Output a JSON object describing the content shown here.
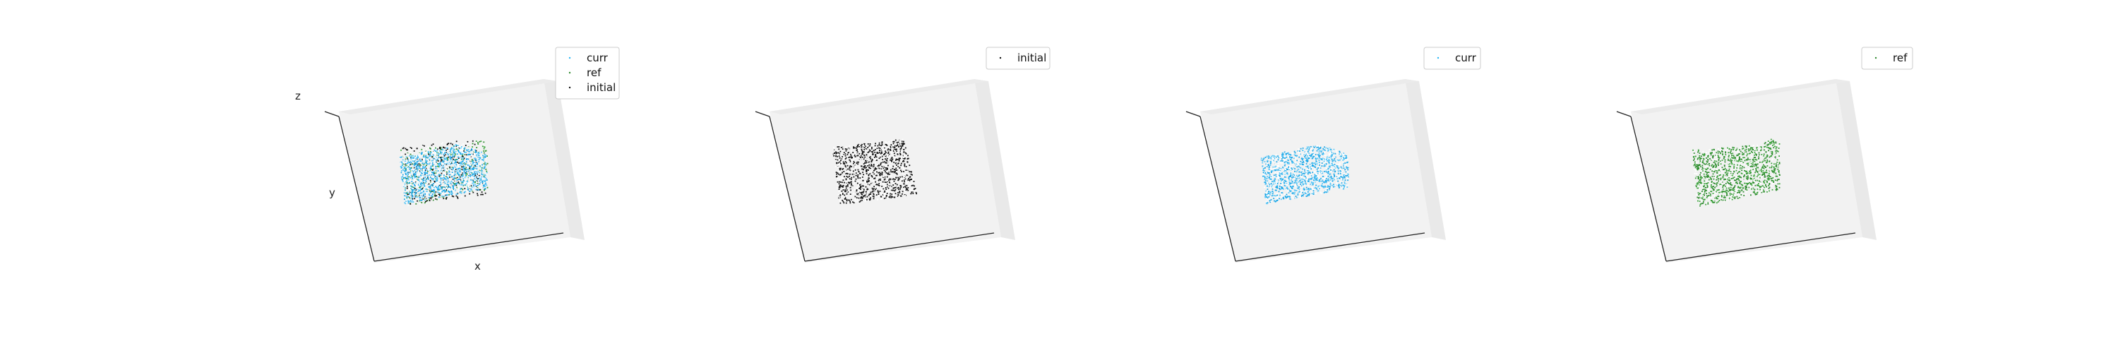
{
  "chart_data": [
    {
      "type": "scatter",
      "title": "",
      "xlabel": "x",
      "ylabel": "y",
      "zlabel": "z",
      "grid": false,
      "legend_placement": "top-right",
      "series": [
        {
          "name": "curr",
          "color": "#29b6f6",
          "x": [],
          "y": [],
          "z": []
        },
        {
          "name": "ref",
          "color": "#2e8b2e",
          "x": [],
          "y": [],
          "z": []
        },
        {
          "name": "initial",
          "color": "#111111",
          "x": [],
          "y": [],
          "z": []
        }
      ]
    },
    {
      "type": "scatter",
      "title": "",
      "xlabel": "",
      "ylabel": "",
      "zlabel": "",
      "grid": false,
      "legend_placement": "top-right",
      "series": [
        {
          "name": "initial",
          "color": "#111111",
          "x": [],
          "y": [],
          "z": []
        }
      ]
    },
    {
      "type": "scatter",
      "title": "",
      "xlabel": "",
      "ylabel": "",
      "zlabel": "",
      "grid": false,
      "legend_placement": "top-right",
      "series": [
        {
          "name": "curr",
          "color": "#29b6f6",
          "x": [],
          "y": [],
          "z": []
        }
      ]
    },
    {
      "type": "scatter",
      "title": "",
      "xlabel": "",
      "ylabel": "",
      "zlabel": "",
      "grid": false,
      "legend_placement": "top-right",
      "series": [
        {
          "name": "ref",
          "color": "#2e8b2e",
          "x": [],
          "y": [],
          "z": []
        }
      ]
    }
  ]
}
